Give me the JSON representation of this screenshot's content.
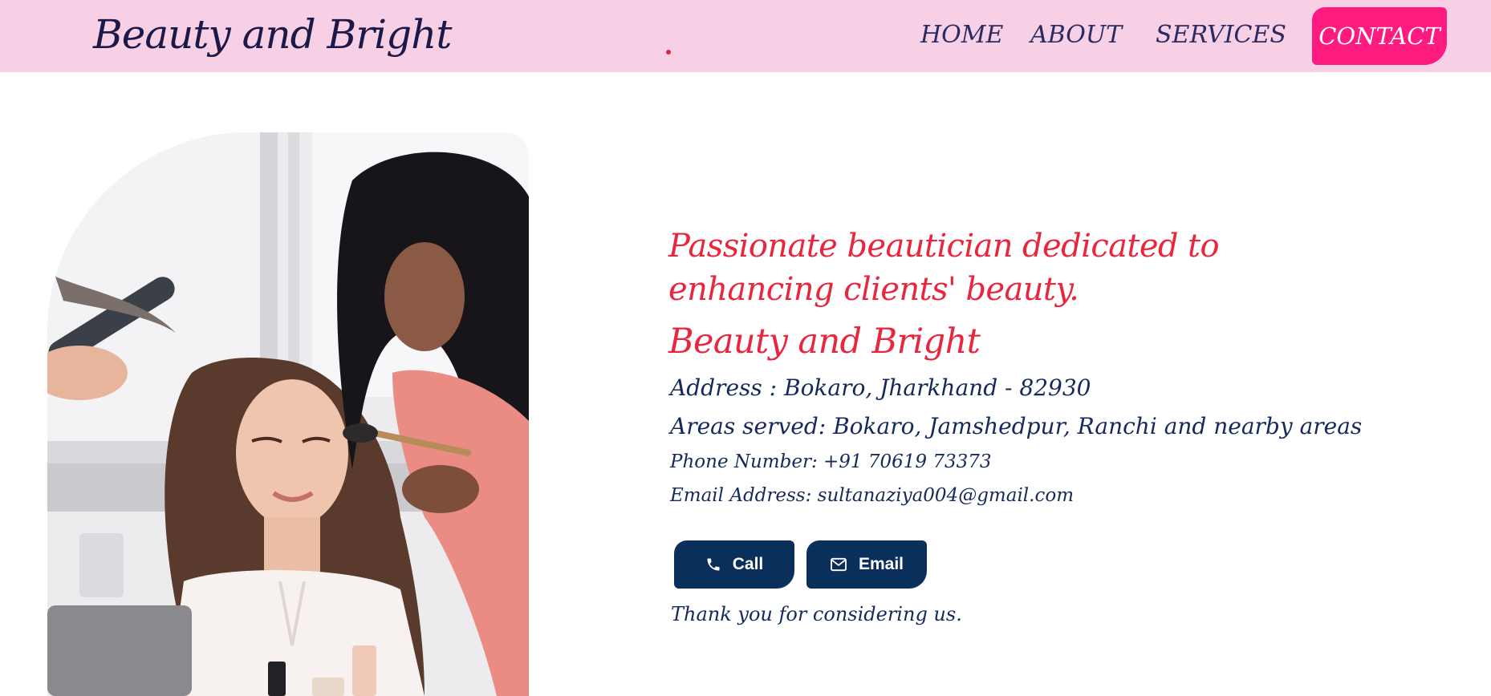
{
  "header": {
    "brand": "Beauty and Bright",
    "nav": [
      {
        "label": "HOME"
      },
      {
        "label": "ABOUT"
      },
      {
        "label": "SERVICES"
      }
    ],
    "contact_label": "CONTACT"
  },
  "colors": {
    "header_bg": "#f8d0e6",
    "accent_pink": "#ff1a80",
    "heading_red": "#e8263e",
    "navy": "#0b2f5b"
  },
  "main": {
    "tagline": "Passionate beautician dedicated to enhancing clients' beauty.",
    "business_name": "Beauty and Bright",
    "address": "Address : Bokaro, Jharkhand - 82930",
    "areas_served": "Areas served: Bokaro, Jamshedpur, Ranchi and nearby areas",
    "phone": "Phone Number: +91 70619 73373",
    "email": "Email Address: sultanaziya004@gmail.com",
    "buttons": {
      "call_label": "Call",
      "call_icon": "phone-icon",
      "email_label": "Email",
      "email_icon": "envelope-icon"
    },
    "thanks": "Thank you for considering us."
  }
}
